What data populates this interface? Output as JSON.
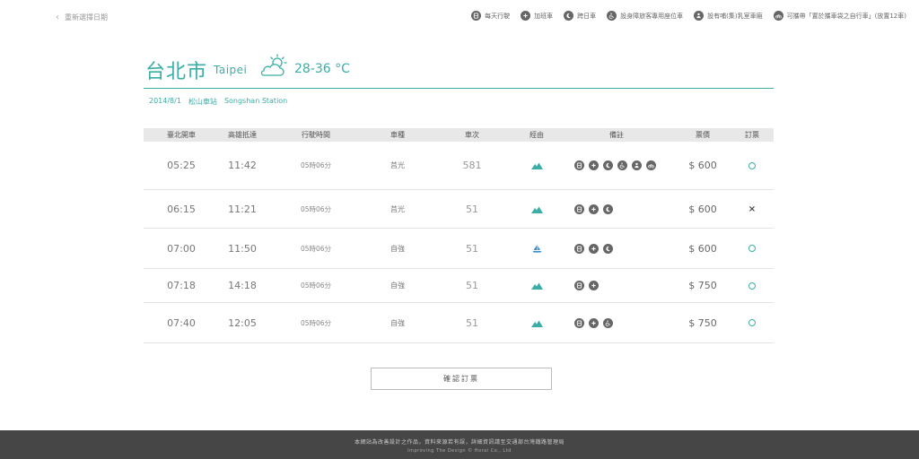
{
  "nav": {
    "back_label": "重新選擇日期"
  },
  "legend": [
    {
      "icon": "daily-icon",
      "label": "每天行駛"
    },
    {
      "icon": "extra-train-icon",
      "label": "加班車"
    },
    {
      "icon": "cross-day-icon",
      "label": "跨日車"
    },
    {
      "icon": "wheelchair-icon",
      "label": "設身障旅客專用座位車"
    },
    {
      "icon": "nursing-room-icon",
      "label": "設有哺(集)乳室車廂"
    },
    {
      "icon": "bicycle-icon",
      "label": "可攜帶「置於攜車袋之自行車」(放置12車)"
    }
  ],
  "header": {
    "city": "台北市",
    "city_en": "Taipei",
    "weather_icon": "partly-cloudy-icon",
    "temperature": "28-36 °C"
  },
  "trip": {
    "date": "2014/8/1",
    "station": "松山車站",
    "station_en": "Songshan Station"
  },
  "table": {
    "columns": [
      "臺北開車",
      "高雄抵達",
      "行駛時間",
      "車種",
      "車次",
      "經由",
      "備註",
      "票價",
      "訂票"
    ],
    "rows": [
      {
        "depart": "05:25",
        "arrive": "11:42",
        "duration": "05時06分",
        "type": "莒光",
        "train_no": "581",
        "route": "mountain-icon",
        "notes": [
          "daily-icon",
          "extra-train-icon",
          "cross-day-icon",
          "wheelchair-icon",
          "nursing-room-icon",
          "bicycle-icon"
        ],
        "price": "$ 600",
        "book": "available"
      },
      {
        "depart": "06:15",
        "arrive": "11:21",
        "duration": "05時06分",
        "type": "莒光",
        "train_no": "51",
        "route": "mountain-icon",
        "notes": [
          "daily-icon",
          "extra-train-icon",
          "cross-day-icon"
        ],
        "price": "$ 600",
        "book": "soldout"
      },
      {
        "depart": "07:00",
        "arrive": "11:50",
        "duration": "05時06分",
        "type": "自強",
        "train_no": "51",
        "route": "sea-icon",
        "notes": [
          "daily-icon",
          "extra-train-icon",
          "cross-day-icon"
        ],
        "price": "$ 600",
        "book": "available"
      },
      {
        "depart": "07:18",
        "arrive": "14:18",
        "duration": "05時06分",
        "type": "自強",
        "train_no": "51",
        "route": "mountain-icon",
        "notes": [
          "daily-icon",
          "extra-train-icon"
        ],
        "price": "$ 750",
        "book": "available"
      },
      {
        "depart": "07:40",
        "arrive": "12:05",
        "duration": "05時06分",
        "type": "自強",
        "train_no": "51",
        "route": "mountain-icon",
        "notes": [
          "daily-icon",
          "extra-train-icon",
          "wheelchair-icon"
        ],
        "price": "$ 750",
        "book": "available"
      }
    ]
  },
  "confirm_label": "確認訂票",
  "footer": {
    "line1": "本網站為改善設計之作品，資料來源若有誤，詳細資訊請至交通部台灣鐵路管理局",
    "line2": "Improving The Design © Horai Co., Ltd"
  },
  "colors": {
    "accent": "#3aaea6",
    "icon_gray": "#666666",
    "footer_bg": "#464646"
  }
}
